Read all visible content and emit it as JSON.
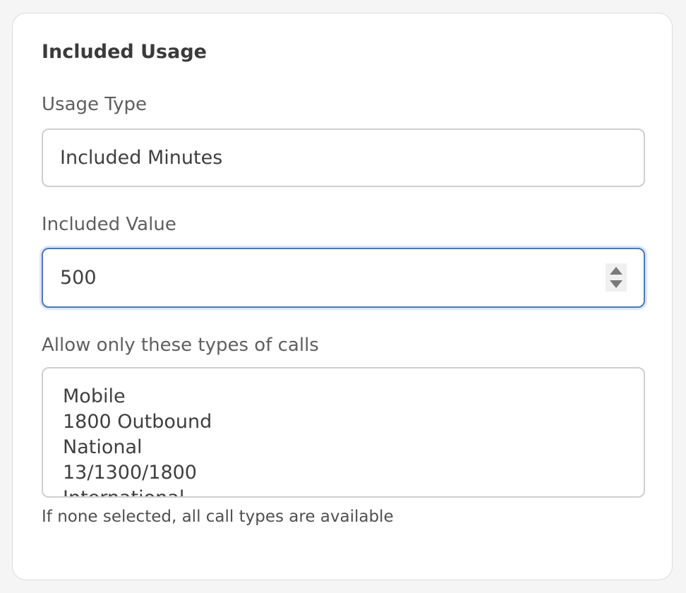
{
  "section": {
    "title": "Included Usage"
  },
  "usage_type": {
    "label": "Usage Type",
    "value": "Included Minutes"
  },
  "included_value": {
    "label": "Included Value",
    "value": "500"
  },
  "call_types": {
    "label": "Allow only these types of calls",
    "options": [
      "Mobile",
      "1800 Outbound",
      "National",
      "13/1300/1800",
      "International"
    ],
    "help": "If none selected, all call types are available"
  },
  "colors": {
    "focus_border": "#4d79b3",
    "focus_ring": "#dbe6f5",
    "input_border": "#cfcfcf"
  }
}
